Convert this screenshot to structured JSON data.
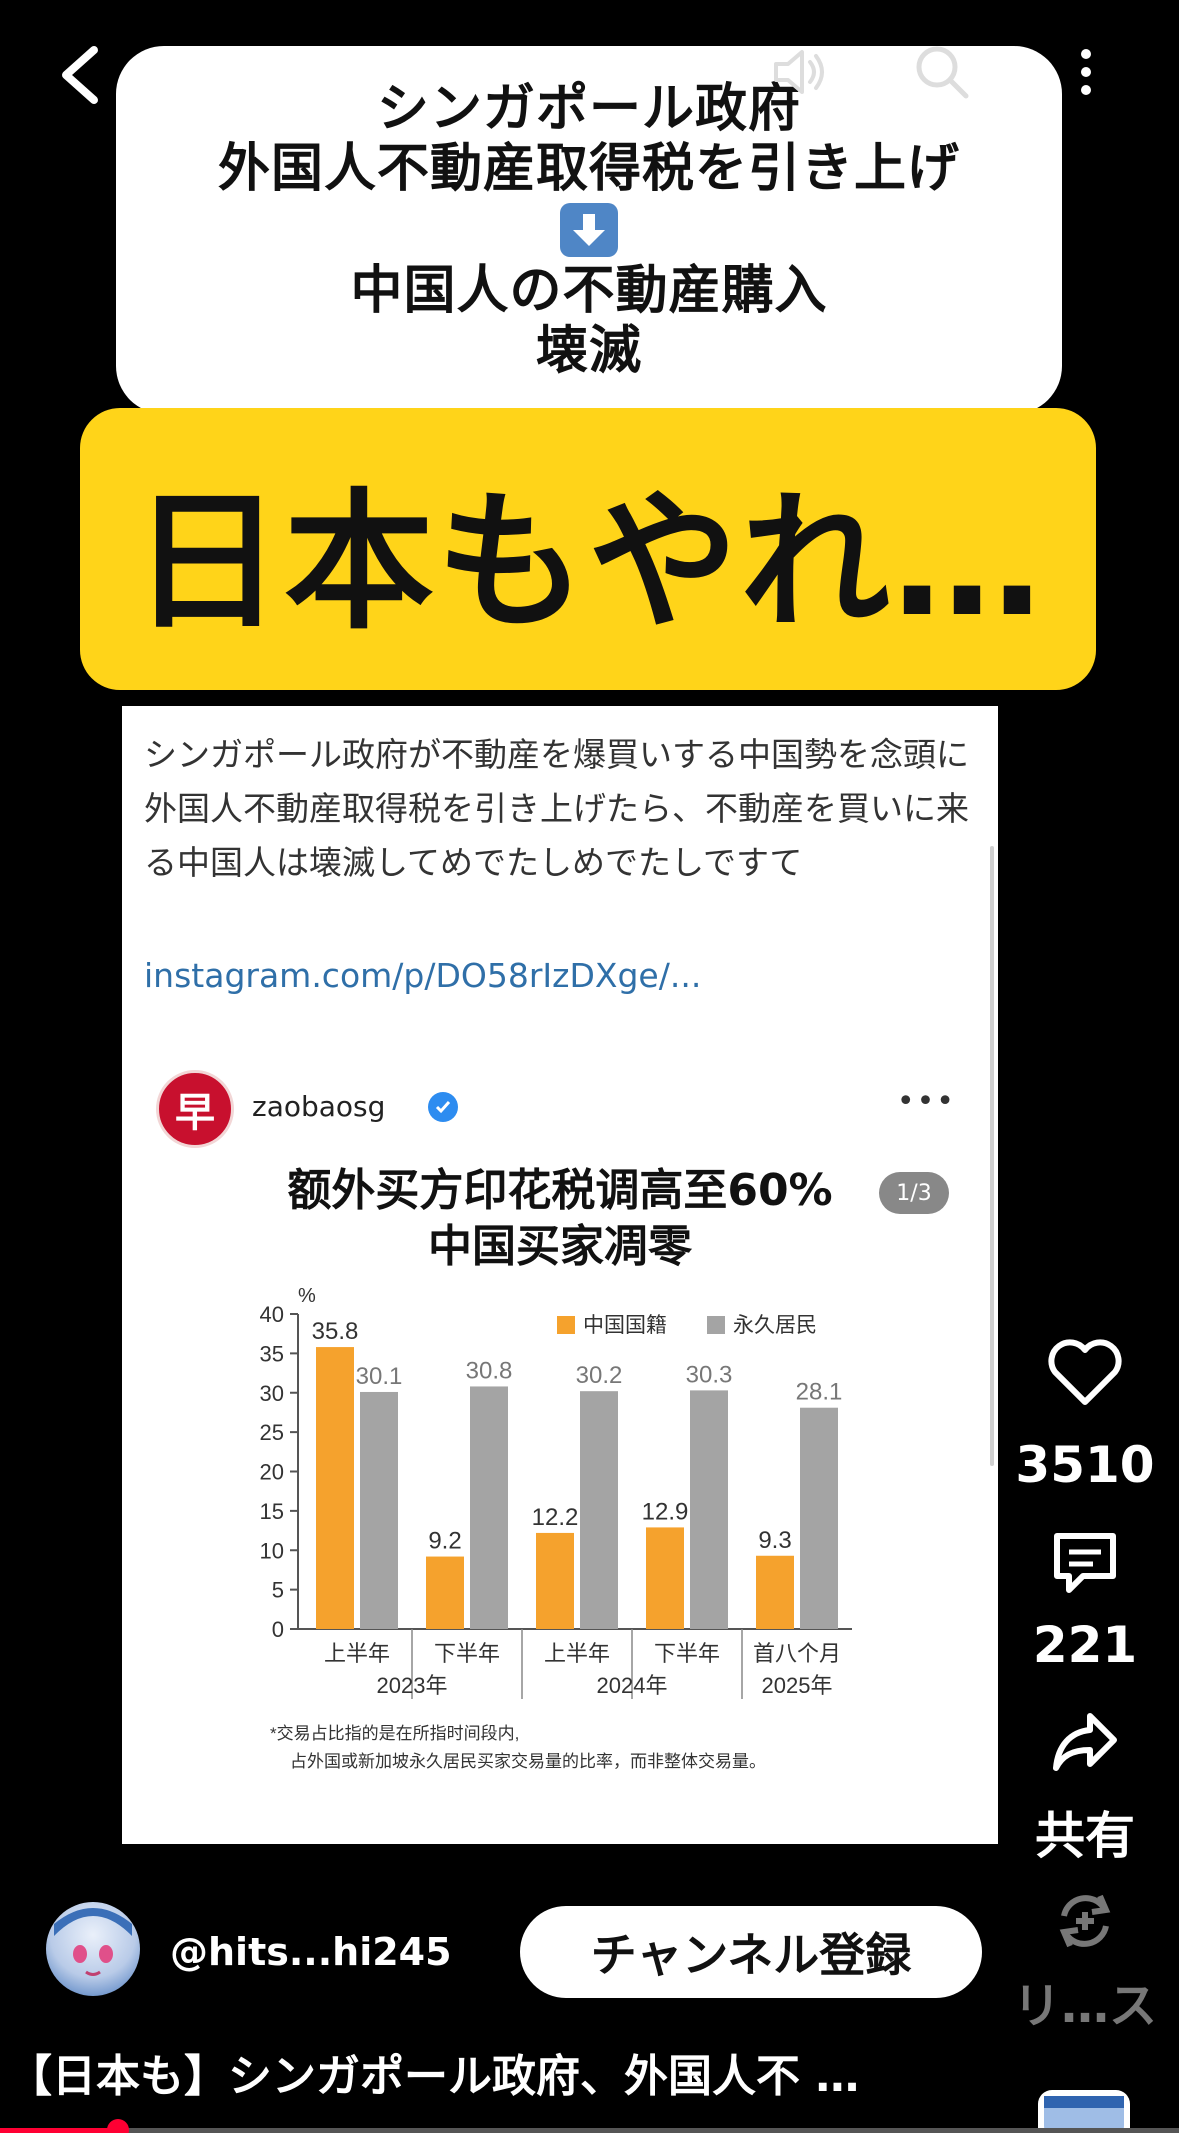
{
  "overlay": {
    "headline_lines": [
      "シンガポール政府",
      "外国人不動産取得税を引き上げ",
      "中国人の不動産購入",
      "壊滅"
    ],
    "banner": "日本もやれ…"
  },
  "embed": {
    "text": "シンガポール政府が不動産を爆買いする中国勢を念頭に外国人不動産取得税を引き上げたら、不動産を買いに来る中国人は壊滅してめでたしめでたしですて",
    "link": "instagram.com/p/DO58rIzDXge/...",
    "account": "zaobaosg",
    "logo_char": "早",
    "more": "•••"
  },
  "chart_data": {
    "type": "bar",
    "title": "额外买方印花税调高至60%",
    "subtitle": "中国买家凋零",
    "page": "1/3",
    "ylabel": "%",
    "ylim": [
      0,
      40
    ],
    "yticks": [
      0,
      5,
      10,
      15,
      20,
      25,
      30,
      35,
      40
    ],
    "categories": [
      "上半年",
      "下半年",
      "上半年",
      "下半年",
      "首八个月"
    ],
    "year_labels": [
      {
        "label": "2023年",
        "span": [
          0,
          1
        ]
      },
      {
        "label": "2024年",
        "span": [
          2,
          3
        ]
      },
      {
        "label": "2025年",
        "span": [
          4,
          4
        ]
      }
    ],
    "series": [
      {
        "name": "中国国籍",
        "color": "#f5a22d",
        "values": [
          35.8,
          9.2,
          12.2,
          12.9,
          9.3
        ]
      },
      {
        "name": "永久居民",
        "color": "#a4a4a4",
        "values": [
          30.1,
          30.8,
          30.2,
          30.3,
          28.1
        ]
      }
    ],
    "legend": "top-right",
    "grid": false,
    "footnote": [
      "*交易占比指的是在所指时间段内,",
      "占外国或新加坡永久居民买家交易量的比率，而非整体交易量。"
    ]
  },
  "side": {
    "likes": "3510",
    "comments": "221",
    "share": "共有",
    "remix": "リ…ス"
  },
  "channel": {
    "handle": "@hits...hi245",
    "subscribe": "チャンネル登録"
  },
  "video": {
    "title": "【日本も】シンガポール政府、外国人不 …",
    "progress": 0.1
  },
  "colors": {
    "banner_bg": "#ffd419",
    "bar_china": "#f5a22d",
    "bar_pr": "#a4a4a4",
    "progress": "#ff0033",
    "link": "#2f6fa8"
  }
}
